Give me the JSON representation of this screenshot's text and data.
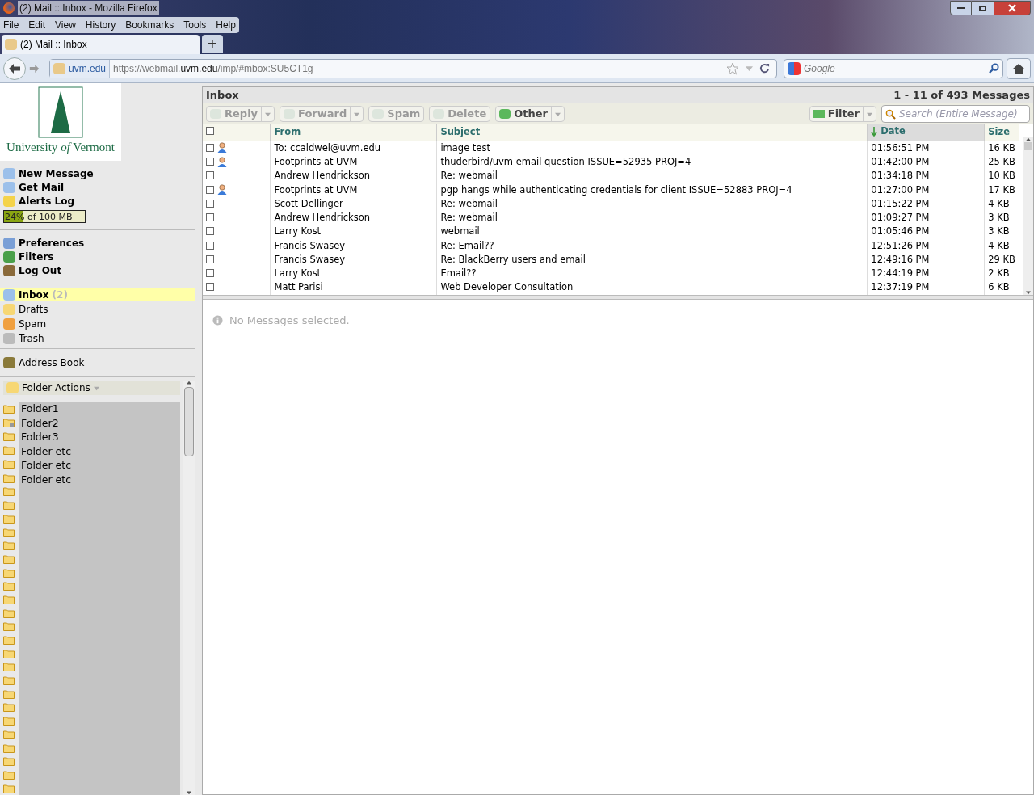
{
  "window": {
    "title": "(2) Mail :: Inbox - Mozilla Firefox"
  },
  "menu": [
    "File",
    "Edit",
    "View",
    "History",
    "Bookmarks",
    "Tools",
    "Help"
  ],
  "tabs": [
    {
      "label": "(2) Mail :: Inbox",
      "selected": true
    }
  ],
  "new_tab": "+",
  "address_bar": {
    "site": "uvm.edu",
    "url": "https://webmail.**uvm.edu**/imp/#mbox:SU5CT1g"
  },
  "search_bar": {
    "placeholder": "Google"
  },
  "sidebar": {
    "logo_text": "University *of* Vermont",
    "actions": [
      "New Message",
      "Get Mail",
      "Alerts Log"
    ],
    "quota": {
      "percent": "24%",
      "text": "of 100 MB",
      "level": 0.24
    },
    "settings": [
      "Preferences",
      "Filters",
      "Log Out"
    ],
    "mailboxes": [
      {
        "kind": "inbox",
        "label": "Inbox",
        "count": "(2)",
        "selected": true
      },
      {
        "kind": "drafts",
        "label": "Drafts",
        "selected": false
      },
      {
        "kind": "spam",
        "label": "Spam",
        "selected": false
      },
      {
        "kind": "trash",
        "label": "Trash",
        "selected": false
      }
    ],
    "address_book": "Address Book",
    "folder_actions": "Folder Actions",
    "folders": [
      {
        "label": "Folder1",
        "kind": "plain"
      },
      {
        "label": "Folder2",
        "kind": "shared"
      },
      {
        "label": "Folder3",
        "kind": "plain"
      },
      {
        "label": "Folder etc",
        "kind": "plain"
      },
      {
        "label": "Folder etc",
        "kind": "plain"
      },
      {
        "label": "Folder etc",
        "kind": "plain"
      }
    ]
  },
  "mailbox": {
    "title": "Inbox",
    "range": "1 - 11 of 493 Messages",
    "toolbar": [
      {
        "label": "Reply",
        "disabled": true,
        "menu": true
      },
      {
        "label": "Forward",
        "disabled": true,
        "menu": true
      },
      {
        "label": "Spam",
        "disabled": true,
        "menu": false
      },
      {
        "label": "Delete",
        "disabled": true,
        "menu": false
      },
      {
        "label": "Other",
        "disabled": false,
        "menu": true
      }
    ],
    "select_all_checked": false,
    "filter": "Filter",
    "search_placeholder": "Search (Entire Message)",
    "columns": [
      {
        "label": "From",
        "sorted": false
      },
      {
        "label": "Subject",
        "sorted": false
      },
      {
        "label": "Date",
        "sorted": true
      },
      {
        "label": "Size",
        "sorted": false
      }
    ],
    "rows": [
      {
        "checked": false,
        "contact": true,
        "from": "To: ccaldwel@uvm.edu",
        "subject": "image test",
        "date": "01:56:51 PM",
        "size": "16 KB"
      },
      {
        "checked": false,
        "contact": true,
        "from": "Footprints at UVM",
        "subject": "thuderbird/uvm email question ISSUE=52935 PROJ=4",
        "date": "01:42:00 PM",
        "size": "25 KB"
      },
      {
        "checked": false,
        "contact": false,
        "from": "Andrew Hendrickson",
        "subject": "Re: webmail",
        "date": "01:34:18 PM",
        "size": "10 KB"
      },
      {
        "checked": false,
        "contact": true,
        "from": "Footprints at UVM",
        "subject": "pgp hangs while authenticating credentials for client ISSUE=52883 PROJ=4",
        "date": "01:27:00 PM",
        "size": "17 KB"
      },
      {
        "checked": false,
        "contact": false,
        "from": "Scott Dellinger",
        "subject": "Re: webmail",
        "date": "01:15:22 PM",
        "size": "4 KB"
      },
      {
        "checked": false,
        "contact": false,
        "from": "Andrew Hendrickson",
        "subject": "Re: webmail",
        "date": "01:09:27 PM",
        "size": "3 KB"
      },
      {
        "checked": false,
        "contact": false,
        "from": "Larry Kost",
        "subject": "webmail",
        "date": "01:05:46 PM",
        "size": "3 KB"
      },
      {
        "checked": false,
        "contact": false,
        "from": "Francis Swasey",
        "subject": "Re: Email??",
        "date": "12:51:26 PM",
        "size": "4 KB"
      },
      {
        "checked": false,
        "contact": false,
        "from": "Francis Swasey",
        "subject": "Re: BlackBerry users and email",
        "date": "12:49:16 PM",
        "size": "29 KB"
      },
      {
        "checked": false,
        "contact": false,
        "from": "Larry Kost",
        "subject": "Email??",
        "date": "12:44:19 PM",
        "size": "2 KB"
      },
      {
        "checked": false,
        "contact": false,
        "from": "Matt Parisi",
        "subject": "Web Developer Consultation",
        "date": "12:37:19 PM",
        "size": "6 KB"
      }
    ]
  },
  "preview": {
    "message": "No Messages selected."
  }
}
